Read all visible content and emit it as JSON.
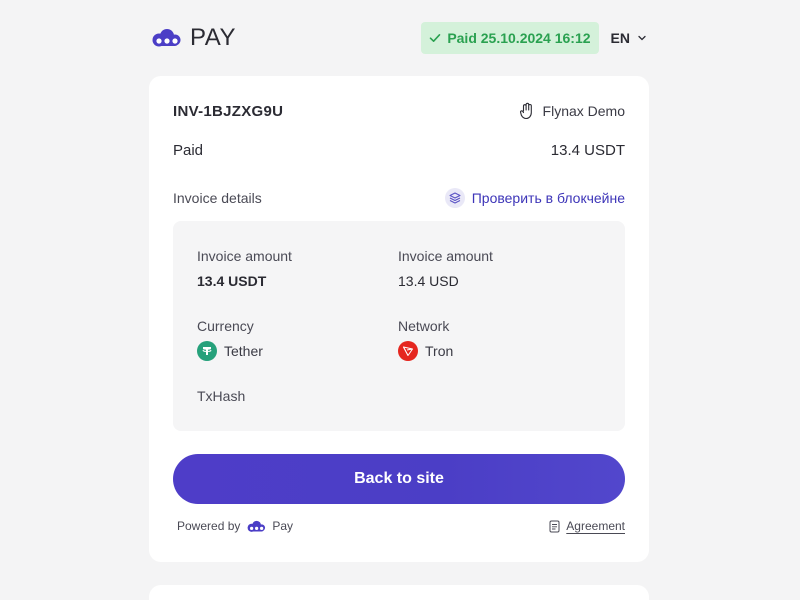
{
  "header": {
    "brand": "PAY",
    "status_badge": "Paid 25.10.2024 16:12",
    "language": "EN"
  },
  "invoice": {
    "id": "INV-1BJZXG9U",
    "merchant": "Flynax Demo",
    "status": "Paid",
    "amount": "13.4 USDT",
    "details_label": "Invoice details",
    "verify_link": "Проверить в блокчейне"
  },
  "details": {
    "amount_crypto_label": "Invoice amount",
    "amount_crypto_value": "13.4 USDT",
    "amount_fiat_label": "Invoice amount",
    "amount_fiat_value": "13.4 USD",
    "currency_label": "Currency",
    "currency_value": "Tether",
    "network_label": "Network",
    "network_value": "Tron",
    "txhash_label": "TxHash"
  },
  "actions": {
    "back_button": "Back to site"
  },
  "footer": {
    "powered_by": "Powered by",
    "powered_brand": "Pay",
    "agreement": "Agreement"
  },
  "colors": {
    "accent": "#4b3ec6",
    "paid_bg": "#d4f1da",
    "paid_text": "#2aa150",
    "tether": "#26a17b",
    "tron": "#e5261f"
  }
}
